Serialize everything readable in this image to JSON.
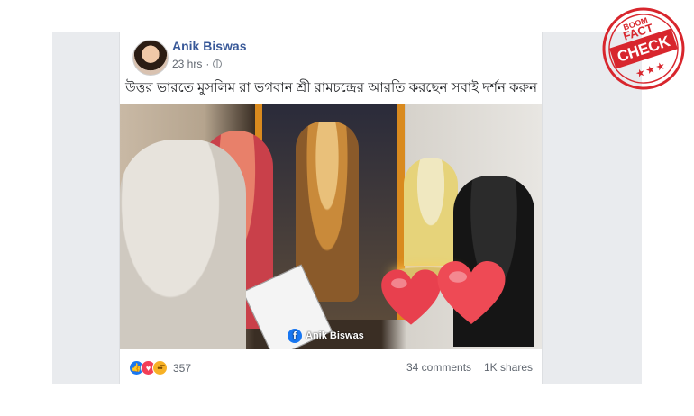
{
  "post": {
    "author": "Anik Biswas",
    "time": "23 hrs",
    "text": "উত্তর ভারতে মুসলিম রা ভগবান শ্রী রামচন্দ্রের আরতি করছেন সবাই দর্শন করুন",
    "video_watermark": "Anik Biswas",
    "reaction_count": "357",
    "comments": "34 comments",
    "shares": "1K shares"
  },
  "stamp": {
    "top": "BOOM",
    "line1": "FACT",
    "line2": "CHECK",
    "stars": "★ ★ ★"
  },
  "colors": {
    "author_link": "#385898",
    "stamp_red": "#d8262d",
    "like_blue": "#1877f2",
    "love_red": "#f33e58",
    "sad_yellow": "#f7b125"
  },
  "icons": [
    "globe-icon",
    "facebook-icon",
    "like-reaction-icon",
    "love-reaction-icon",
    "sad-reaction-icon",
    "heart-icon"
  ]
}
